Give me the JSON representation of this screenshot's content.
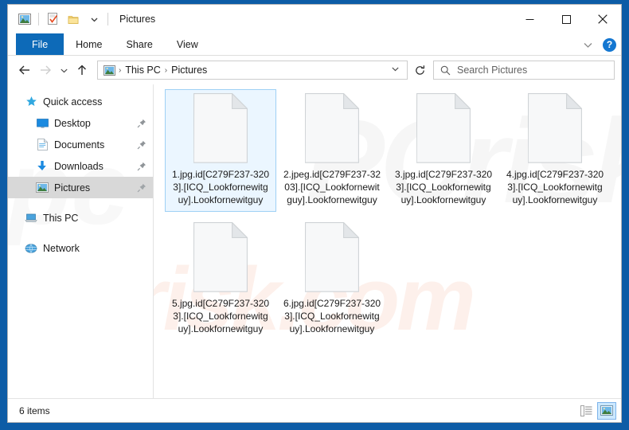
{
  "window": {
    "title": "Pictures",
    "titlebar_icons": [
      "pictures-icon",
      "properties-checkbox-icon",
      "new-folder-icon",
      "customize-chevron-icon"
    ],
    "controls": {
      "minimize": "—",
      "maximize": "☐",
      "close": "✕"
    },
    "frame_color": "#0d5ca6"
  },
  "ribbon": {
    "tabs": [
      {
        "label": "File",
        "active": true
      },
      {
        "label": "Home",
        "active": false
      },
      {
        "label": "Share",
        "active": false
      },
      {
        "label": "View",
        "active": false
      }
    ],
    "expand_icon": "chevron-down-icon",
    "help_label": "?",
    "accent_color": "#0d6ab8"
  },
  "address": {
    "back_icon": "←",
    "forward_icon": "→",
    "recent_icon": "˅",
    "up_icon": "↑",
    "breadcrumb": [
      "This PC",
      "Pictures"
    ],
    "breadcrumb_separator": "›",
    "dropdown_icon": "˅",
    "refresh_icon": "↻"
  },
  "search": {
    "placeholder": "Search Pictures",
    "icon": "search-icon"
  },
  "sidebar": {
    "groups": [
      {
        "label": "Quick access",
        "icon": "star-pin-icon",
        "items": [
          {
            "label": "Desktop",
            "icon": "desktop-icon",
            "pinned": true,
            "selected": false
          },
          {
            "label": "Documents",
            "icon": "documents-icon",
            "pinned": true,
            "selected": false
          },
          {
            "label": "Downloads",
            "icon": "downloads-icon",
            "pinned": true,
            "selected": false
          },
          {
            "label": "Pictures",
            "icon": "pictures-icon",
            "pinned": true,
            "selected": true
          }
        ]
      },
      {
        "label": "This PC",
        "icon": "this-pc-icon",
        "items": []
      },
      {
        "label": "Network",
        "icon": "network-icon",
        "items": []
      }
    ]
  },
  "files": [
    {
      "name": "1.jpg.id[C279F237-3203].[ICQ_Lookfornewitguy].Lookfornewitguy",
      "icon": "blank-file-icon",
      "selected": true
    },
    {
      "name": "2.jpeg.id[C279F237-3203].[ICQ_Lookfornewitguy].Lookfornewitguy",
      "icon": "blank-file-icon",
      "selected": false
    },
    {
      "name": "3.jpg.id[C279F237-3203].[ICQ_Lookfornewitguy].Lookfornewitguy",
      "icon": "blank-file-icon",
      "selected": false
    },
    {
      "name": "4.jpg.id[C279F237-3203].[ICQ_Lookfornewitguy].Lookfornewitguy",
      "icon": "blank-file-icon",
      "selected": false
    },
    {
      "name": "5.jpg.id[C279F237-3203].[ICQ_Lookfornewitguy].Lookfornewitguy",
      "icon": "blank-file-icon",
      "selected": false
    },
    {
      "name": "6.jpg.id[C279F237-3203].[ICQ_Lookfornewitguy].Lookfornewitguy",
      "icon": "blank-file-icon",
      "selected": false
    }
  ],
  "watermark": {
    "top_text": "PCrisk",
    "bottom_text": "risk.com",
    "side_text": "pc"
  },
  "status": {
    "item_count": "6 items",
    "views": [
      {
        "name": "details-view",
        "active": false
      },
      {
        "name": "large-icons-view",
        "active": true
      }
    ]
  }
}
